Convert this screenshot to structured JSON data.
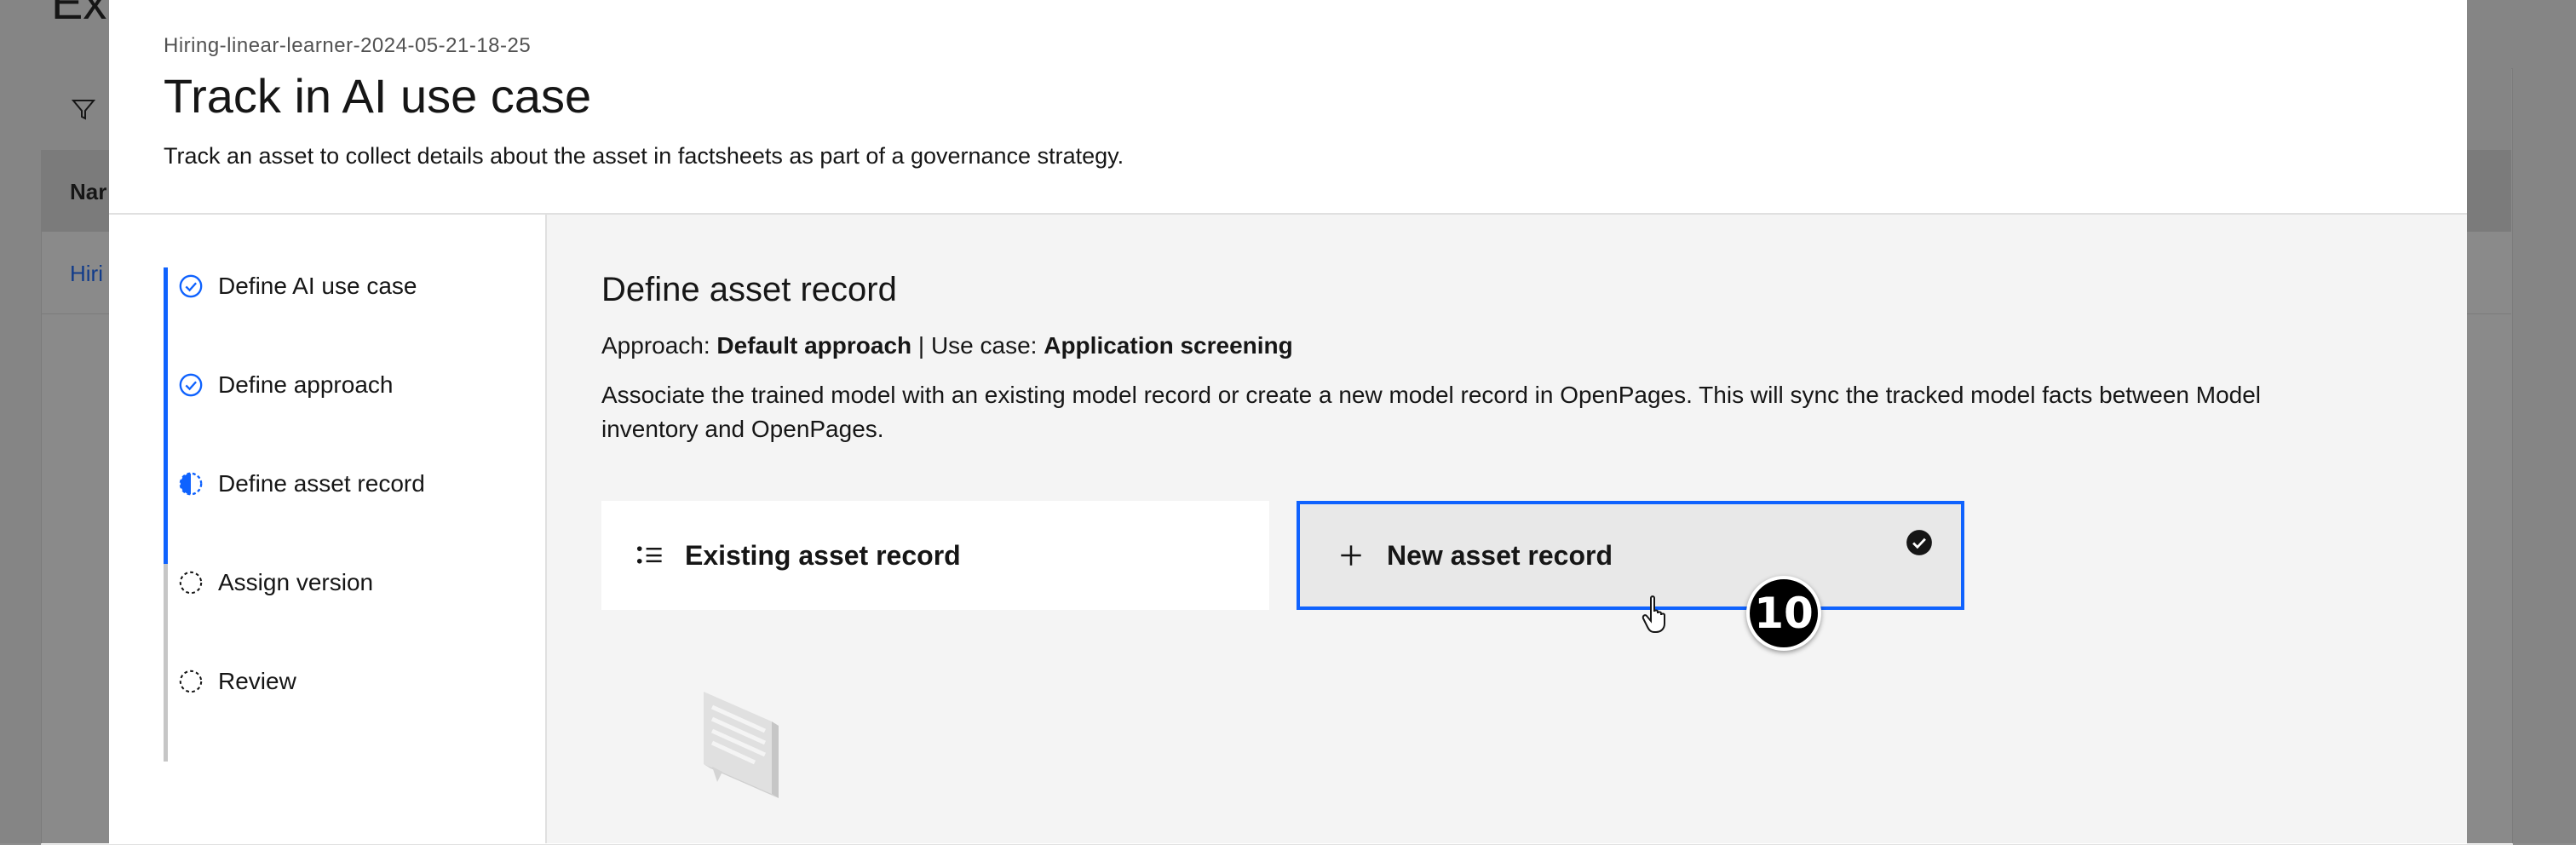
{
  "background_page": {
    "title": "Ex",
    "table_header": "Nar",
    "table_cell": "Hiri"
  },
  "modal": {
    "asset_name": "Hiring-linear-learner-2024-05-21-18-25",
    "title": "Track in AI use case",
    "description": "Track an asset to collect details about the asset in factsheets as part of a governance strategy."
  },
  "stepper": {
    "steps": [
      {
        "label": "Define AI use case",
        "state": "complete",
        "icon": "checkmark-outline-icon"
      },
      {
        "label": "Define approach",
        "state": "complete",
        "icon": "checkmark-outline-icon"
      },
      {
        "label": "Define asset record",
        "state": "current",
        "icon": "incomplete-half-icon"
      },
      {
        "label": "Assign version",
        "state": "incomplete",
        "icon": "circle-dash-icon"
      },
      {
        "label": "Review",
        "state": "incomplete",
        "icon": "circle-dash-icon"
      }
    ]
  },
  "main": {
    "section_title": "Define asset record",
    "approach_label": "Approach: ",
    "approach_value": "Default approach",
    "separator": " | Use case: ",
    "use_case_value": "Application screening",
    "description": "Associate the trained model with an existing model record or create a new model record in OpenPages. This will sync the tracked model facts between Model inventory and OpenPages.",
    "tiles": [
      {
        "label": "Existing asset record",
        "icon": "list-bulleted-icon",
        "selected": false
      },
      {
        "label": "New asset record",
        "icon": "add-icon",
        "selected": true
      }
    ]
  },
  "tutorial": {
    "step_number": "10"
  },
  "colors": {
    "accent": "#0f62fe",
    "text": "#161616",
    "secondary_text": "#525252",
    "main_bg": "#f4f4f4",
    "selected_tile_bg": "#e8e8e8"
  }
}
